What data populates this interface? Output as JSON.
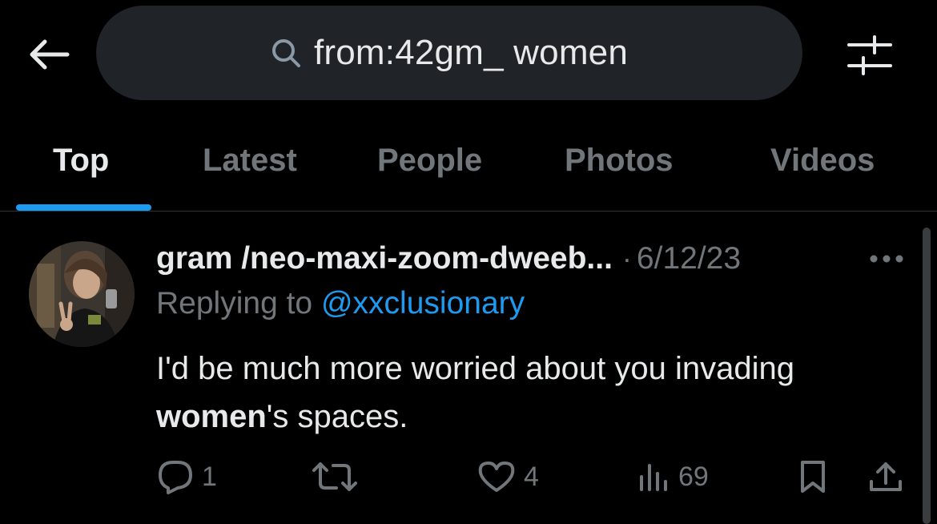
{
  "search": {
    "query": "from:42gm_ women"
  },
  "tabs": [
    {
      "label": "Top",
      "active": true
    },
    {
      "label": "Latest",
      "active": false
    },
    {
      "label": "People",
      "active": false
    },
    {
      "label": "Photos",
      "active": false
    },
    {
      "label": "Videos",
      "active": false
    }
  ],
  "tweet": {
    "display_name": "gram /neo-maxi-zoom-dweeb...",
    "separator": "·",
    "date": "6/12/23",
    "replying_prefix": "Replying to",
    "replying_handle": "@xxclusionary",
    "text_part1": "I'd be much more worried about you invading ",
    "text_bold": "women",
    "text_part2": "'s spaces.",
    "actions": {
      "replies": "1",
      "retweets": "",
      "likes": "4",
      "views": "69"
    }
  },
  "colors": {
    "background": "#000000",
    "accent": "#1d9bf0",
    "muted_text": "#71767b",
    "primary_text": "#e7e9ea",
    "search_bg": "#202327"
  },
  "icons": [
    "back-arrow-icon",
    "search-icon",
    "filter-sliders-icon",
    "more-dots-icon",
    "reply-icon",
    "retweet-icon",
    "like-icon",
    "views-icon",
    "bookmark-icon",
    "share-icon"
  ]
}
